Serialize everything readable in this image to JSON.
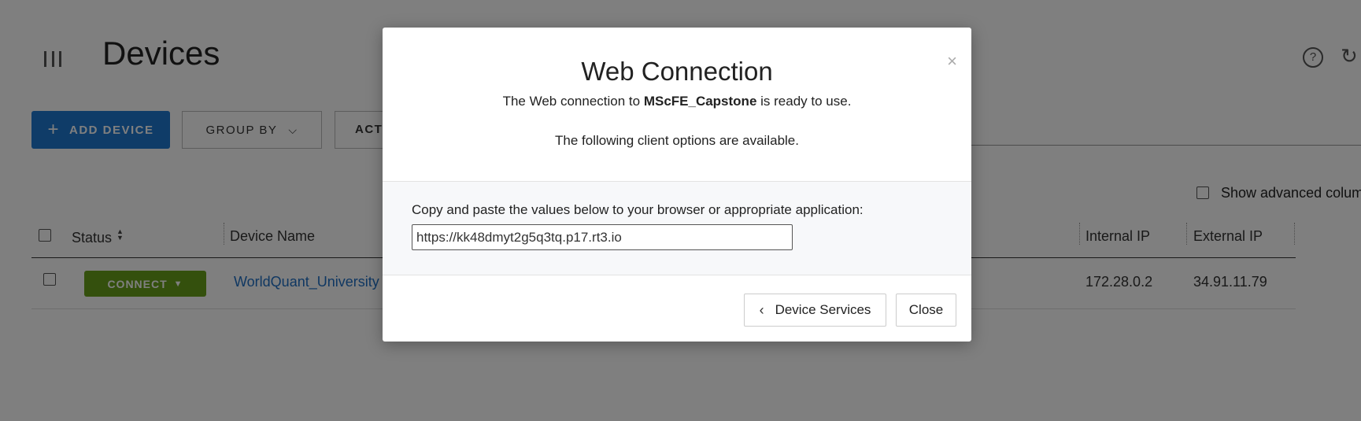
{
  "page": {
    "title": "Devices",
    "toolbar": {
      "add_device_label": "ADD DEVICE",
      "group_by_label": "GROUP BY",
      "actions_label": "ACTI"
    },
    "show_advanced_label": "Show advanced colum",
    "table": {
      "columns": {
        "status": "Status",
        "device_name": "Device Name",
        "internal_ip": "Internal IP",
        "external_ip": "External IP"
      },
      "rows": [
        {
          "connect_label": "CONNECT",
          "device_name": "WorldQuant_University",
          "internal_ip": "172.28.0.2",
          "external_ip": "34.91.11.79"
        }
      ]
    }
  },
  "modal": {
    "title": "Web Connection",
    "subtitle_prefix": "The Web connection to ",
    "device_name": "MScFE_Capstone",
    "subtitle_suffix": " is ready to use.",
    "options_text": "The following client options are available.",
    "copy_instruction": "Copy and paste the values below to your browser or appropriate application:",
    "url_value": "https://kk48dmyt2g5q3tq.p17.rt3.io",
    "device_services_label": "Device Services",
    "close_label": "Close",
    "close_x": "×"
  },
  "colors": {
    "primary": "#1f78d1",
    "connect_green": "#68a11a",
    "link": "#1f6fc4",
    "overlay": "rgba(0,0,0,0.5)"
  }
}
